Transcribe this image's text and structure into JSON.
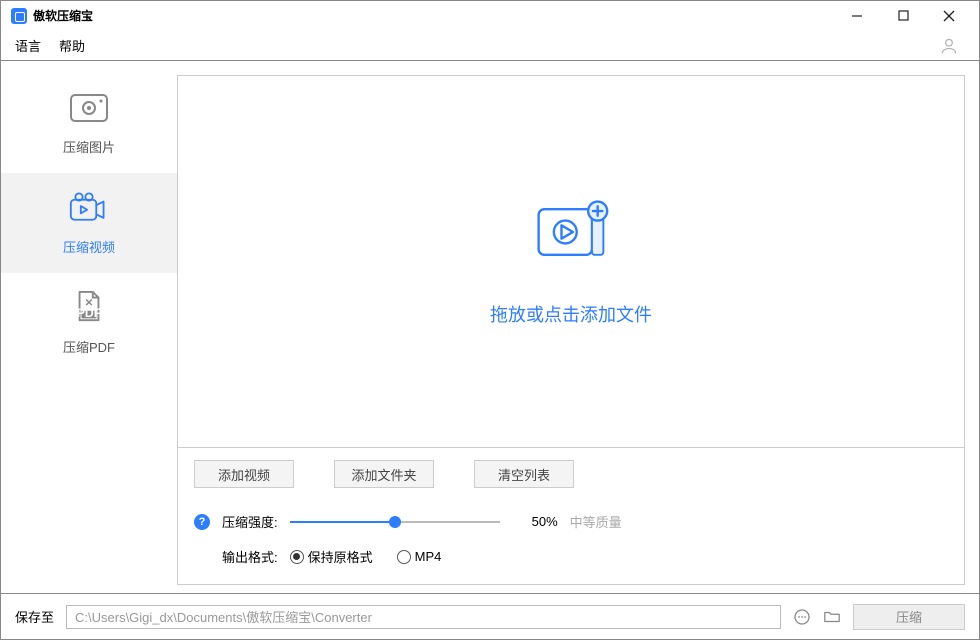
{
  "titlebar": {
    "title": "傲软压缩宝"
  },
  "menu": {
    "language": "语言",
    "help": "帮助"
  },
  "sidebar": {
    "items": [
      {
        "label": "压缩图片"
      },
      {
        "label": "压缩视频"
      },
      {
        "label": "压缩PDF"
      }
    ]
  },
  "main": {
    "drop_text": "拖放或点击添加文件",
    "buttons": {
      "add_video": "添加视频",
      "add_folder": "添加文件夹",
      "clear_list": "清空列表"
    },
    "compress_strength_label": "压缩强度:",
    "compress_strength_value": "50%",
    "compress_quality_hint": "中等质量",
    "output_format_label": "输出格式:",
    "radios": {
      "keep_original": "保持原格式",
      "mp4": "MP4"
    }
  },
  "footer": {
    "save_to_label": "保存至",
    "save_to_path": "C:\\Users\\Gigi_dx\\Documents\\傲软压缩宝\\Converter",
    "compress_btn": "压缩"
  }
}
